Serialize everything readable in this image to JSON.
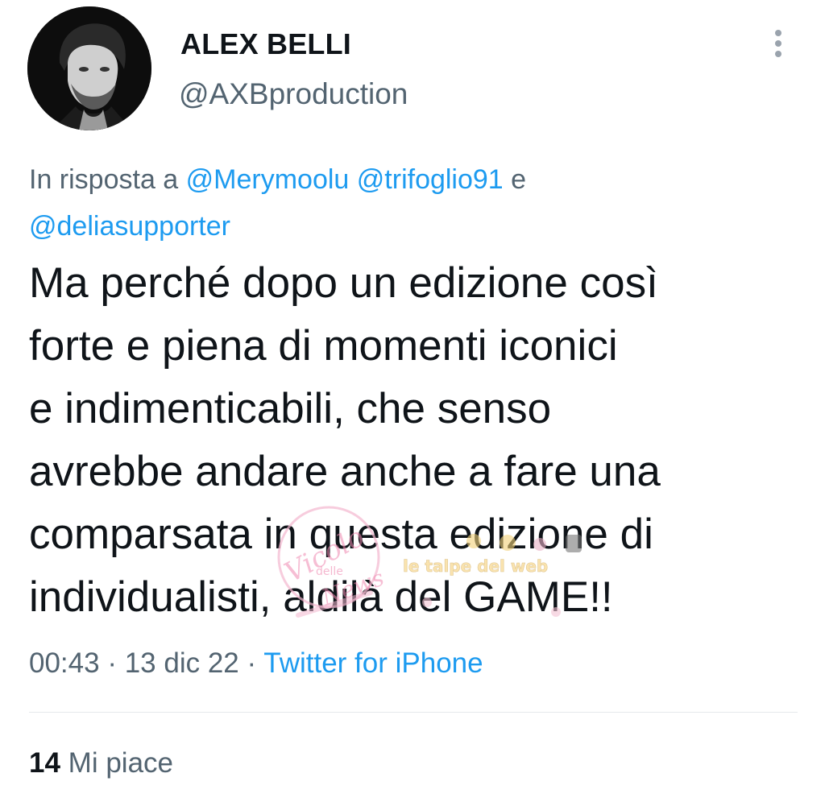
{
  "author": {
    "display_name": "ALEX BELLI",
    "username": "@AXBproduction",
    "avatar_icon": "profile-photo"
  },
  "more_icon": "vertical-ellipsis-icon",
  "reply_context": {
    "prefix": "In risposta a ",
    "mentions": [
      "@Merymoolu",
      "@trifoglio91",
      "@deliasupporter"
    ],
    "conjunction": " e "
  },
  "tweet": {
    "lines": [
      "Ma perché dopo un edizione così",
      "forte e piena di momenti iconici",
      "e indimenticabili, che senso",
      "avrebbe andare anche a fare una",
      "comparsata in questa edizione di",
      "individualisti, aldilà del GAME!!"
    ]
  },
  "meta": {
    "time": "00:43",
    "separator": " · ",
    "date": "13 dic 22",
    "source": "Twitter for iPhone"
  },
  "stats": {
    "likes_count": "14",
    "likes_label": "Mi piace"
  },
  "watermark": {
    "text_left": "Vicolo delle News",
    "text_right": "le talpe del web"
  },
  "colors": {
    "text_primary": "#0f1419",
    "text_secondary": "#536471",
    "link": "#1d9bf0",
    "divider": "#e6e9ec"
  }
}
